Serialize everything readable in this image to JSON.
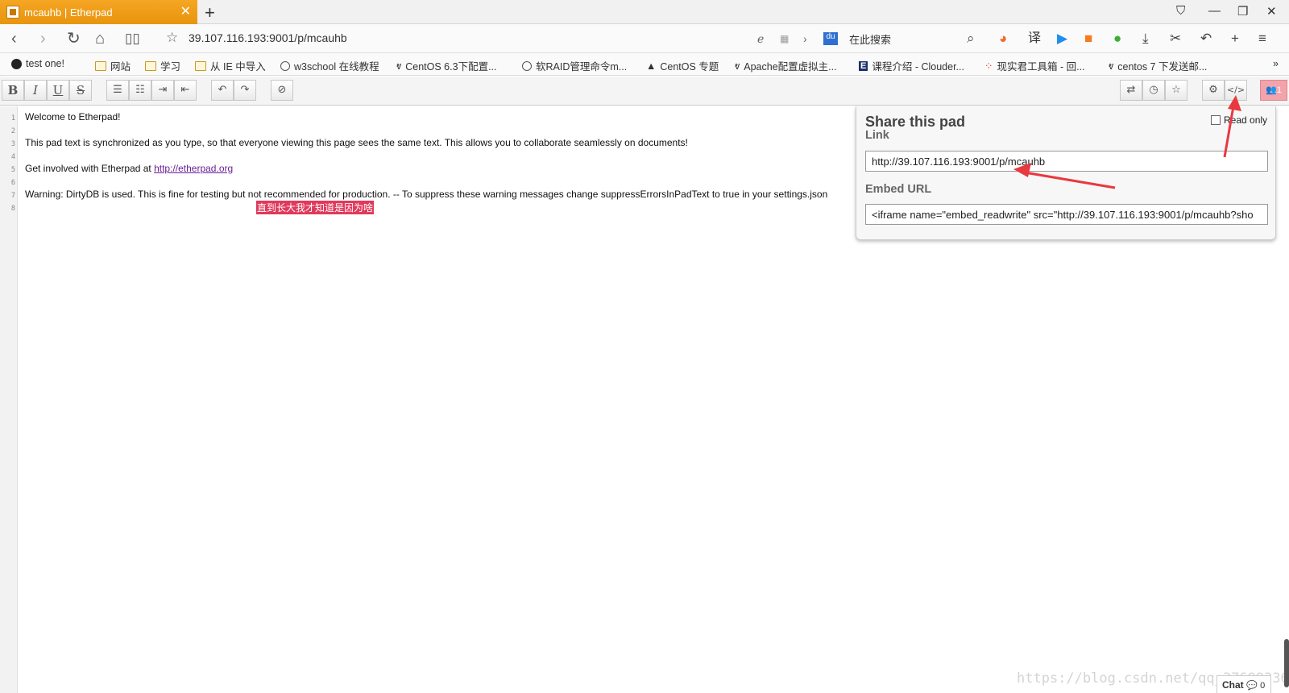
{
  "browser": {
    "tab_title": "mcauhb | Etherpad",
    "tab_close": "✕",
    "new_tab": "+",
    "url": "39.107.116.193:9001/p/mcauhb",
    "search_placeholder": "在此搜索",
    "search_logo": "du",
    "translate_label": "译"
  },
  "bookmarks": [
    {
      "label": "test one!",
      "icon": "ball-icon"
    },
    {
      "label": "网站",
      "icon": "folder-icon"
    },
    {
      "label": "学习",
      "icon": "folder-icon"
    },
    {
      "label": "从 IE 中导入",
      "icon": "folder-icon"
    },
    {
      "label": "w3school 在线教程",
      "icon": "globe-icon"
    },
    {
      "label": "CentOS 6.3下配置...",
      "icon": "link-icon"
    },
    {
      "label": "软RAID管理命令m...",
      "icon": "globe-icon"
    },
    {
      "label": "CentOS 专题",
      "icon": "tux-icon"
    },
    {
      "label": "Apache配置虚拟主...",
      "icon": "link-icon"
    },
    {
      "label": "课程介绍 - Clouder...",
      "icon": "e-icon"
    },
    {
      "label": "现实君工具箱 - 回...",
      "icon": "dots-icon"
    },
    {
      "label": "centos 7 下发送邮...",
      "icon": "link-icon"
    }
  ],
  "toolbar": {
    "bold": "B",
    "italic": "I",
    "underline": "U",
    "strike": "S",
    "user_count": "1"
  },
  "editor": {
    "line_numbers": [
      "1",
      "2",
      "3",
      "4",
      "5",
      "6",
      "7",
      "8"
    ],
    "line1": "Welcome to Etherpad!",
    "line3": "This pad text is synchronized as you type, so that everyone viewing this page sees the same text. This allows you to collaborate seamlessly on documents!",
    "line5_prefix": "Get involved with Etherpad at ",
    "line5_link": "http://etherpad.org",
    "line7": "Warning: DirtyDB is used. This is fine for testing but not recommended for production. -- To suppress these warning messages change suppressErrorsInPadText to true in your settings.json",
    "highlight": "直到长大我才知道是因为啥"
  },
  "share": {
    "title": "Share this pad",
    "link_label": "Link",
    "link_value": "http://39.107.116.193:9001/p/mcauhb",
    "embed_label": "Embed URL",
    "embed_value": "<iframe name=\"embed_readwrite\" src=\"http://39.107.116.193:9001/p/mcauhb?sho",
    "readonly_label": "Read only"
  },
  "chat": {
    "label": "Chat",
    "count": "0"
  },
  "watermark": "https://blog.csdn.net/qq_37699336",
  "colors": {
    "tab": "#f5a623",
    "arrow": "#e8393f",
    "highlight": "#e0395c"
  }
}
